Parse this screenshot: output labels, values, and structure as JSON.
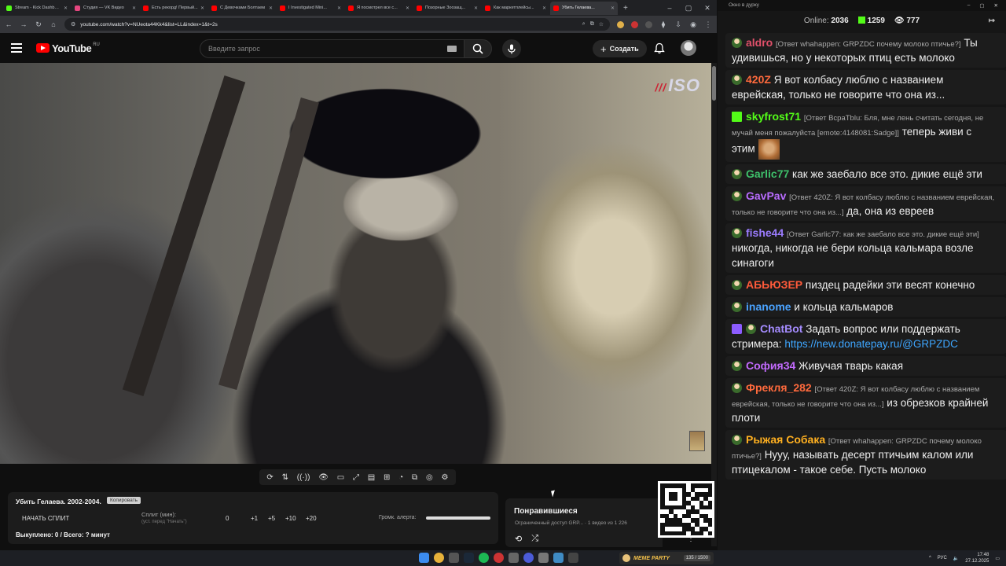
{
  "browser": {
    "tabs": [
      {
        "label": "Stream - Kick Dashboard",
        "color": "#53fc18",
        "active": false
      },
      {
        "label": "Студия — VK Видео",
        "color": "#e5467f",
        "active": false
      },
      {
        "label": "Есть рекорд! Первый...",
        "color": "#ff0000",
        "active": false
      },
      {
        "label": "С Девочками Болтаем",
        "color": "#ff0000",
        "active": false
      },
      {
        "label": "I Investigated Mini...",
        "color": "#ff0000",
        "active": false
      },
      {
        "label": "Я посмотрел все с...",
        "color": "#ff0000",
        "active": false
      },
      {
        "label": "Позорные Зоозащ...",
        "color": "#ff0000",
        "active": false
      },
      {
        "label": "Как маркетплейсы...",
        "color": "#ff0000",
        "active": false
      },
      {
        "label": "Убить Гелаева...",
        "color": "#ff0000",
        "active": true
      }
    ],
    "new_tab": "+",
    "url": "youtube.com/watch?v=NUeota44Kk4&list=LL&index=1&t=2s"
  },
  "youtube": {
    "logo_word": "YouTube",
    "region": "RU",
    "search_placeholder": "Введите запрос",
    "create_label": "Создать"
  },
  "video": {
    "watermark": "ISO"
  },
  "player_tools": [
    "⟳",
    "⇅",
    "((·))",
    "👁",
    "▭",
    "⤢",
    "▤",
    "⊞",
    "◔",
    "⧉",
    "◎",
    "⚙"
  ],
  "panel": {
    "title": "Убить Гелаева. 2002-2004.",
    "copy_label": "Копировать",
    "start_split": "НАЧАТЬ СПЛИТ",
    "split_label": "Сплит (мин):",
    "split_hint": "(уст. перед \"Начать\")",
    "split_value": "0",
    "increments": [
      "+1",
      "+5",
      "+10",
      "+20"
    ],
    "alert_volume_label": "Громк. алерта:",
    "bought": "Выкуплено: 0 / Всего: ? минут"
  },
  "liked": {
    "title": "Понравившиеся",
    "subtitle": "Ограниченный доступ  GRP...  · 1 видео из 1 226"
  },
  "chat": {
    "window_title": "Окно в дурку",
    "online_label": "Online:",
    "online_count": "2036",
    "kick_count": "1259",
    "viewer_count": "777",
    "messages": [
      {
        "user": "aldro",
        "color": "#e0506a",
        "reply": "[Ответ whahappen: GRPZDC почему молоко птичье?]",
        "text": "Ты удивишься, но  у некоторых птиц есть молоко",
        "badge": "avatar"
      },
      {
        "user": "420Z",
        "color": "#ff6a3d",
        "reply": "",
        "text": "Я вот колбасу люблю с названием еврейская, только не говорите что она из...",
        "badge": "avatar"
      },
      {
        "user": "skyfrost71",
        "color": "#53fc18",
        "reply": "[Ответ ВсраТblu: Бля, мне лень считать сегодня, не мучай меня пожалуйста [emote:4148081:Sadge]]",
        "text": "теперь живи с этим",
        "badge": "kick",
        "emote": true
      },
      {
        "user": "Garlic77",
        "color": "#3ec16b",
        "reply": "",
        "text": "как же заебало все это. дикие ещё эти",
        "badge": "avatar"
      },
      {
        "user": "GavPav",
        "color": "#b86cff",
        "reply": "[Ответ 420Z: Я вот колбасу люблю с названием еврейская, только не говорите что она из...]",
        "text": "да, она из евреев",
        "badge": "avatar"
      },
      {
        "user": "fishe44",
        "color": "#9b7cff",
        "reply": "[Ответ Garlic77: как же заебало все это. дикие ещё эти]",
        "text": "никогда, никогда не бери кольца кальмара возле синагоги",
        "badge": "avatar"
      },
      {
        "user": "АБЬЮЗЕР",
        "color": "#ff5a3a",
        "reply": "",
        "text": "пиздец радейки эти весят конечно",
        "badge": "avatar"
      },
      {
        "user": "inanome",
        "color": "#4aa3ff",
        "reply": "",
        "text": "и кольца кальмаров",
        "badge": "avatar"
      },
      {
        "user": "ChatBot",
        "color": "#a58cff",
        "reply": "",
        "text": "Задать вопрос или поддержать стримера:",
        "link": "https://new.donatepay.ru/@GRPZDC",
        "badge": "bot"
      },
      {
        "user": "София34",
        "color": "#c46bff",
        "reply": "",
        "text": "Живучая тварь какая",
        "badge": "avatar"
      },
      {
        "user": "Фрекля_282",
        "color": "#ff6a3d",
        "reply": "[Ответ 420Z: Я вот колбасу люблю с названием еврейская, только не говорите что она из...]",
        "text": "из обрезков крайней плоти",
        "badge": "avatar"
      },
      {
        "user": "Рыжая Собака",
        "color": "#ffb020",
        "reply": "[Ответ whahappen: GRPZDC почему молоко птичье?]",
        "text": "Нууу, называть десерт птичьим калом или птицекалом - такое себе. Пусть молоко",
        "badge": "avatar"
      }
    ]
  },
  "taskbar": {
    "widget_name": "MEME PARTY",
    "widget_count": "135 / 1500",
    "lang": "РУС",
    "time": "17:48",
    "date": "27.12.2025"
  }
}
